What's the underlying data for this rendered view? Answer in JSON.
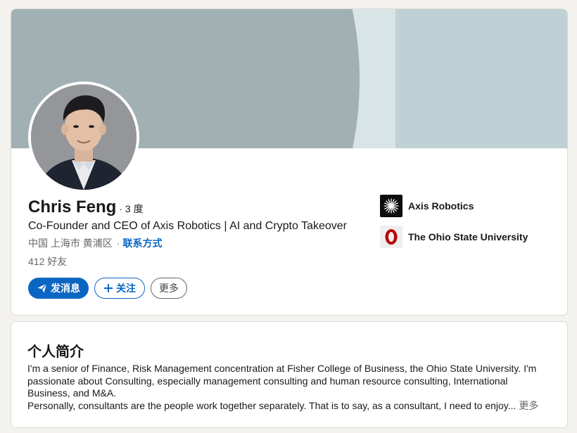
{
  "profile": {
    "name": "Chris Feng",
    "degree": "· 3 度",
    "headline": "Co-Founder and CEO of Axis Robotics | AI and Crypto Takeover",
    "location": "中国 上海市 黄浦区",
    "location_separator": "·",
    "contact_link": "联系方式",
    "connections": "412 好友"
  },
  "actions": {
    "message_label": "发消息",
    "follow_label": "关注",
    "more_label": "更多"
  },
  "orgs": [
    {
      "name": "Axis Robotics",
      "icon": "axis-robotics-logo"
    },
    {
      "name": "The Ohio State University",
      "icon": "ohio-state-logo"
    }
  ],
  "about": {
    "title": "个人简介",
    "paragraph1": "I'm a senior of Finance, Risk Management concentration at Fisher College of Business, the Ohio State University. I'm passionate about Consulting, especially management consulting and human resource consulting, International Business, and M&A.",
    "paragraph2": "Personally, consultants are the people work together separately. That is to say, as a consultant, I need to enjoy...",
    "see_more": "更多"
  },
  "colors": {
    "accent": "#0a66c2",
    "banner_light": "#bfd1d5",
    "banner_dark": "#a0b0b3",
    "osu_red": "#bb0000"
  }
}
